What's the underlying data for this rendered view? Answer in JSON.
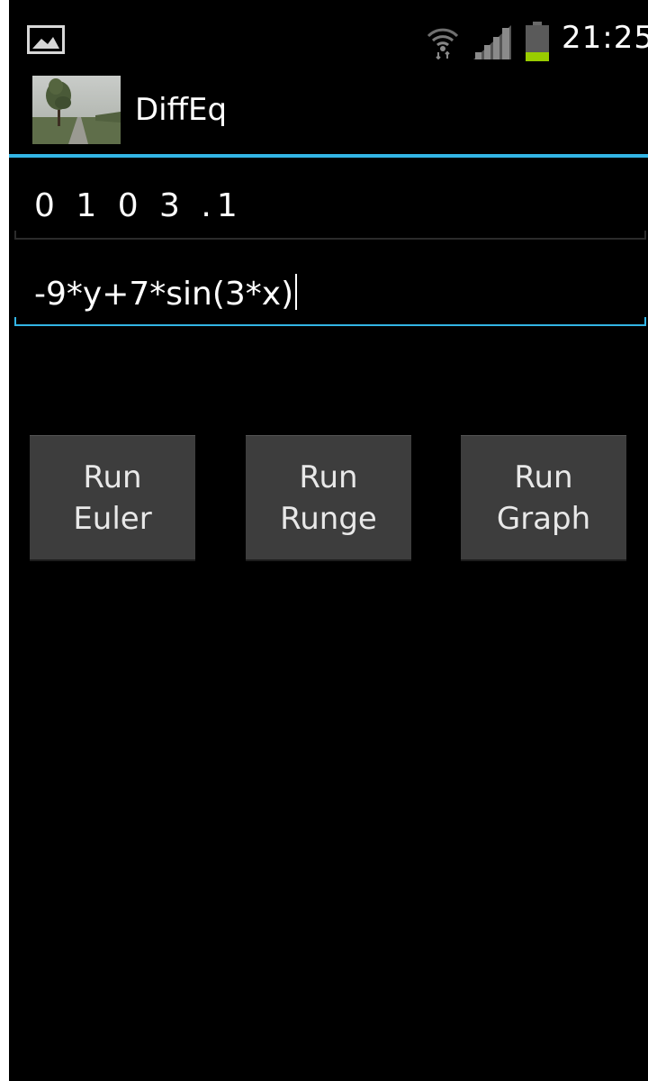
{
  "status_bar": {
    "time": "21:25",
    "icons": [
      "picture-notification-icon",
      "wifi-icon",
      "signal-icon",
      "battery-icon"
    ]
  },
  "action_bar": {
    "title": "DiffEq",
    "logo_icon": "landscape-app-icon"
  },
  "inputs": {
    "params_value": "0 1 0 3 .1",
    "equation_value": "-9*y+7*sin(3*x)"
  },
  "buttons": {
    "euler_label": "Run\nEuler",
    "runge_label": "Run\nRunge",
    "graph_label": "Run\nGraph"
  },
  "colors": {
    "accent": "#33b5e5",
    "background": "#000000",
    "button": "#3d3d3d",
    "battery": "#99cc00"
  }
}
